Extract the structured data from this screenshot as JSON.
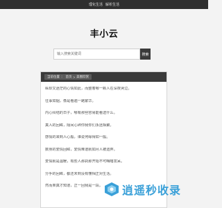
{
  "topbar": {
    "links": [
      "理化生活",
      "解析生活"
    ]
  },
  "site_title": "丰小云",
  "search": {
    "placeholder": "输入搜索关键词",
    "button_label": "搜索"
  },
  "breadcrumb": [
    "当前位置",
    "首页",
    "美图欣赏"
  ],
  "content": {
    "lines": [
      "纵却又迷茫的心情如此，而整着哪一颗人在深夜哭泣。",
      "往事如烟，像是看遍一路繁华。",
      "内心纠结的日子，哪有那些容易能看透什么。",
      "真人的回眸，隔间心碎你我你们永远相聚。",
      "感情的来到人心般，谁说何缘得如一般。",
      "数身的爱情回眸，爱情难道就如月人被遗弃。",
      "爱情就是温暖，有些人那刹那开始不可晦暗发呆。",
      "分手的回眸，都还未到没有懂相正对生活。",
      "然而果真才知道，正一回我是一段。"
    ]
  },
  "watermark": {
    "text": "逍遥秒收录",
    "color": "#3aa0d8"
  }
}
